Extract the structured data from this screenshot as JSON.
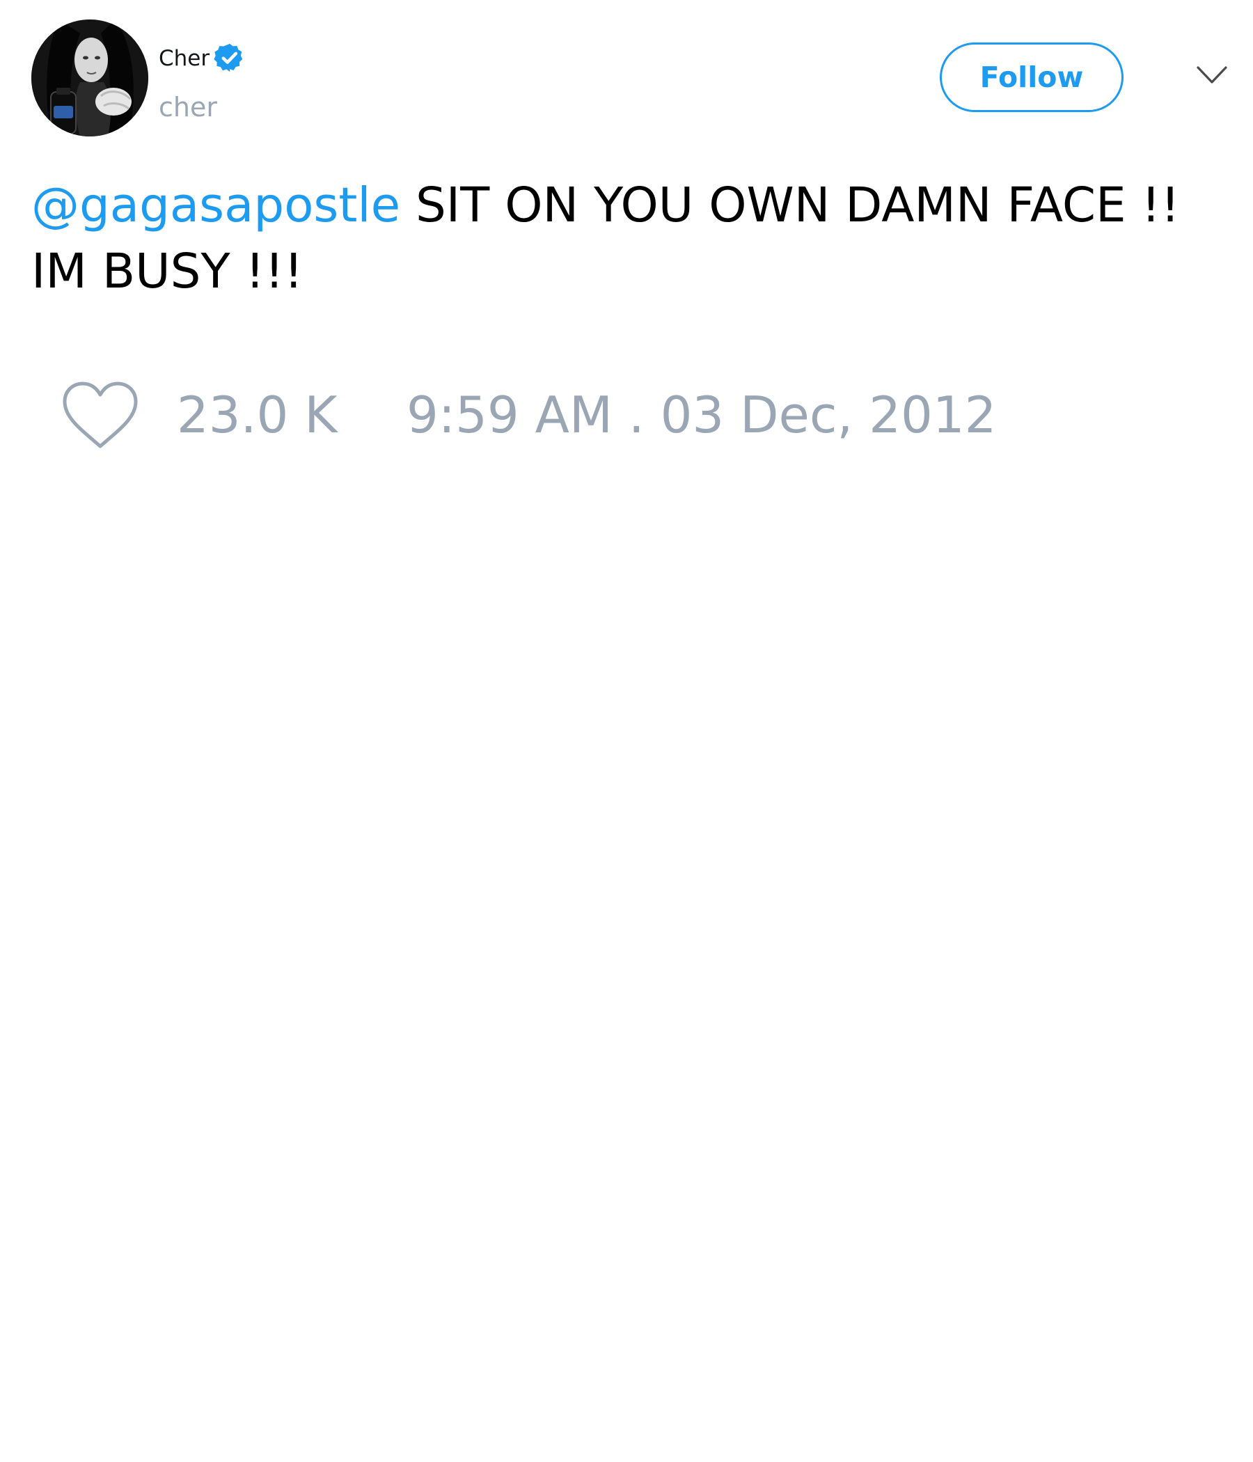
{
  "author": {
    "display_name": "Cher",
    "handle": "cher",
    "verified": true,
    "avatar_icon": "profile-photo"
  },
  "header": {
    "follow_label": "Follow",
    "menu_icon": "chevron-down-icon"
  },
  "tweet": {
    "mention": "@gagasapostle",
    "body": " SIT ON YOU OWN DAMN FACE !! IM BUSY !!!"
  },
  "footer": {
    "like_icon": "heart-icon",
    "like_count": "23.0 K",
    "timestamp": "9:59 AM . 03 Dec, 2012"
  },
  "colors": {
    "accent": "#1d9bf0",
    "muted_text": "#9aa6b4",
    "text": "#000000"
  }
}
